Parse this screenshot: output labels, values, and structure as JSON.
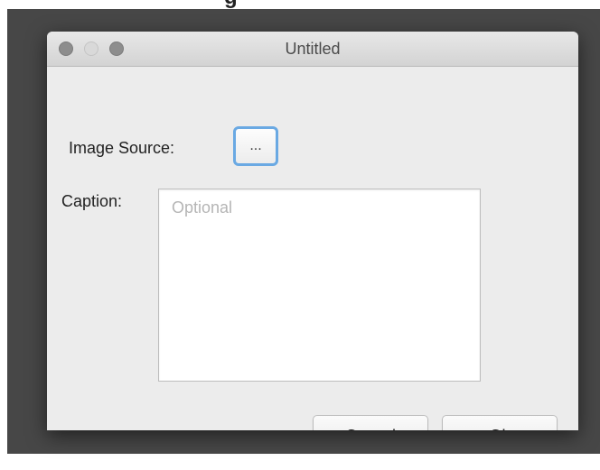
{
  "backdrop": {
    "partial_heading": "g"
  },
  "window": {
    "title": "Untitled",
    "traffic_lights": {
      "close": "close-circle",
      "minimize": "minimize-circle",
      "zoom": "zoom-circle"
    }
  },
  "form": {
    "image_source_label": "Image Source:",
    "browse_button_label": "...",
    "caption_label": "Caption:",
    "caption_placeholder": "Optional",
    "caption_value": ""
  },
  "actions": {
    "cancel_label": "Cancel",
    "ok_label": "Ok"
  },
  "colors": {
    "focus_ring": "#6aa9e3",
    "window_background": "#ececec",
    "desktop_background": "#474747"
  }
}
